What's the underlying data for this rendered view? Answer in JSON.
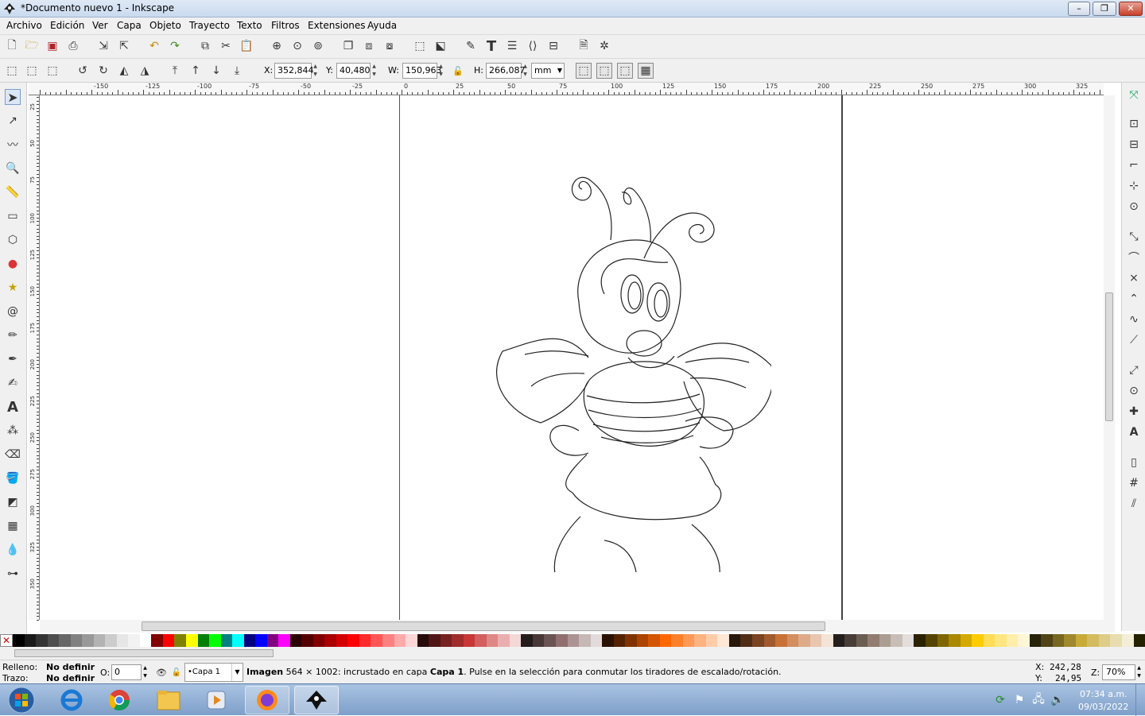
{
  "window": {
    "title": "*Documento nuevo 1 - Inkscape",
    "minimize": "–",
    "maximize": "❐",
    "close": "✕"
  },
  "menu": [
    {
      "label": "Archivo"
    },
    {
      "label": "Edición"
    },
    {
      "label": "Ver"
    },
    {
      "label": "Capa"
    },
    {
      "label": "Objeto"
    },
    {
      "label": "Trayecto"
    },
    {
      "label": "Texto"
    },
    {
      "label": "Filtros"
    },
    {
      "label": "Extensiones"
    },
    {
      "label": "Ayuda"
    }
  ],
  "controls": {
    "x_label": "X:",
    "x_value": "352,844",
    "y_label": "Y:",
    "y_value": "40,480",
    "w_label": "W:",
    "w_value": "150,963",
    "h_label": "H:",
    "h_value": "266,087",
    "unit": "mm"
  },
  "ruler": {
    "h_ticks": [
      "-150",
      "-125",
      "-100",
      "-75",
      "-50",
      "-25",
      "0",
      "25",
      "50",
      "75",
      "100",
      "125",
      "150",
      "175",
      "200",
      "225",
      "250",
      "275",
      "300",
      "325"
    ],
    "v_ticks": [
      "25",
      "50",
      "75",
      "100",
      "125",
      "150",
      "175",
      "200",
      "225",
      "250",
      "275",
      "300",
      "325",
      "350"
    ]
  },
  "status": {
    "fill_label": "Relleno:",
    "fill_value": "No definir",
    "stroke_label": "Trazo:",
    "stroke_value": "No definir",
    "opacity_label": "O:",
    "opacity_value": "0",
    "layer": "•Capa 1",
    "msg_bold1": "Imagen",
    "msg_1": " 564 × 1002: incrustado en capa ",
    "msg_bold2": "Capa 1",
    "msg_2": ". Pulse en la selección para conmutar los tiradores de escalado/rotación.",
    "cursor_x_label": "X:",
    "cursor_x": "242,28",
    "cursor_y_label": "Y:",
    "cursor_y": "24,95",
    "zoom_label": "Z:",
    "zoom": "70%"
  },
  "taskbar": {
    "time": "07:34 a.m.",
    "date": "09/03/2022"
  },
  "palette": [
    "#000000",
    "#1a1a1a",
    "#333333",
    "#4d4d4d",
    "#666666",
    "#808080",
    "#999999",
    "#b3b3b3",
    "#cccccc",
    "#e6e6e6",
    "#f2f2f2",
    "#ffffff",
    "#800000",
    "#ff0000",
    "#808000",
    "#ffff00",
    "#008000",
    "#00ff00",
    "#008080",
    "#00ffff",
    "#000080",
    "#0000ff",
    "#800080",
    "#ff00ff",
    "#2b0000",
    "#550000",
    "#800000",
    "#aa0000",
    "#d40000",
    "#ff0000",
    "#ff2a2a",
    "#ff5555",
    "#ff8080",
    "#ffaaaa",
    "#ffd5d5",
    "#280b0b",
    "#501616",
    "#782121",
    "#a02c2c",
    "#c83737",
    "#d35f5f",
    "#de8787",
    "#e9afaf",
    "#f4d7d7",
    "#241c1c",
    "#483737",
    "#6c5353",
    "#916f6f",
    "#ac9393",
    "#c8b7b7",
    "#e3dbdb",
    "#2b1100",
    "#552200",
    "#803300",
    "#aa4400",
    "#d45500",
    "#ff6600",
    "#ff7f2a",
    "#ff9955",
    "#ffb380",
    "#ffccaa",
    "#ffe6d5",
    "#28170b",
    "#502d16",
    "#784421",
    "#a05a2c",
    "#c87137",
    "#d38d5f",
    "#deaa87",
    "#e9c6af",
    "#f4e3d7",
    "#241f1c",
    "#483e37",
    "#6c5d53",
    "#917c6f",
    "#ac9d93",
    "#c8beb7",
    "#e3dedb",
    "#2b2200",
    "#554400",
    "#806600",
    "#aa8800",
    "#d4aa00",
    "#ffcc00",
    "#ffdd55",
    "#ffe680",
    "#ffeeaa",
    "#fff6d5",
    "#28220b",
    "#504416",
    "#786721",
    "#a0892c",
    "#c8ab37",
    "#d4bb5f",
    "#decd87",
    "#e9ddaf",
    "#f4eed7",
    "#242200"
  ]
}
